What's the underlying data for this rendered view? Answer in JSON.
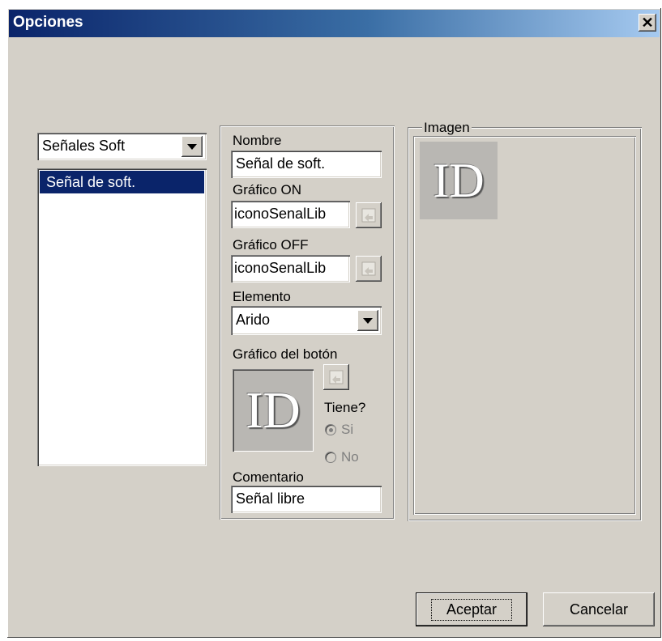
{
  "window": {
    "title": "Opciones",
    "close_glyph": "✕"
  },
  "left_panel": {
    "dropdown_value": "Señales Soft",
    "list_items": [
      "Señal de soft."
    ],
    "selected_index": 0
  },
  "form": {
    "nombre_label": "Nombre",
    "nombre_value": "Señal de soft.",
    "grafico_on_label": "Gráfico ON",
    "grafico_on_value": "iconoSenalLib",
    "grafico_off_label": "Gráfico OFF",
    "grafico_off_value": "iconoSenalLib",
    "elemento_label": "Elemento",
    "elemento_value": "Arido",
    "grafico_boton_label": "Gráfico del botón",
    "boton_image_text": "ID",
    "tiene_label": "Tiene?",
    "radio_si": "Si",
    "radio_no": "No",
    "radio_selected": "Si",
    "comentario_label": "Comentario",
    "comentario_value": "Señal libre"
  },
  "imagen": {
    "label": "Imagen",
    "image_text": "ID"
  },
  "buttons": {
    "aceptar": "Aceptar",
    "cancelar": "Cancelar"
  },
  "colors": {
    "face": "#d4d0c8",
    "title_start": "#0a246a",
    "title_end": "#a6caf0",
    "selection": "#0a246a"
  },
  "icons": [
    "close-icon",
    "dropdown-arrow-icon",
    "browse-file-icon",
    "id-image-icon"
  ]
}
